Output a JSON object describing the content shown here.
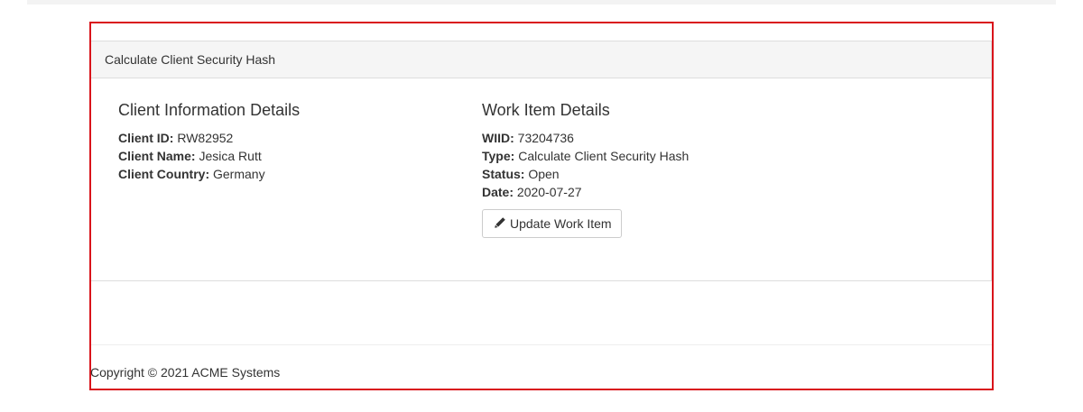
{
  "panel": {
    "title": "Calculate Client Security Hash"
  },
  "client": {
    "heading": "Client Information Details",
    "fields": [
      {
        "label": "Client ID:",
        "value": "RW82952"
      },
      {
        "label": "Client Name:",
        "value": "Jesica Rutt"
      },
      {
        "label": "Client Country:",
        "value": "Germany"
      }
    ]
  },
  "work_item": {
    "heading": "Work Item Details",
    "fields": [
      {
        "label": "WIID:",
        "value": "73204736"
      },
      {
        "label": "Type:",
        "value": "Calculate Client Security Hash"
      },
      {
        "label": "Status:",
        "value": "Open"
      },
      {
        "label": "Date:",
        "value": "2020-07-27"
      }
    ],
    "update_button_label": "Update Work Item",
    "update_button_icon": "pencil-icon"
  },
  "footer": {
    "copyright": "Copyright © 2021 ACME Systems"
  },
  "colors": {
    "frame_border": "#d9141b",
    "panel_heading_bg": "#f5f5f5"
  }
}
